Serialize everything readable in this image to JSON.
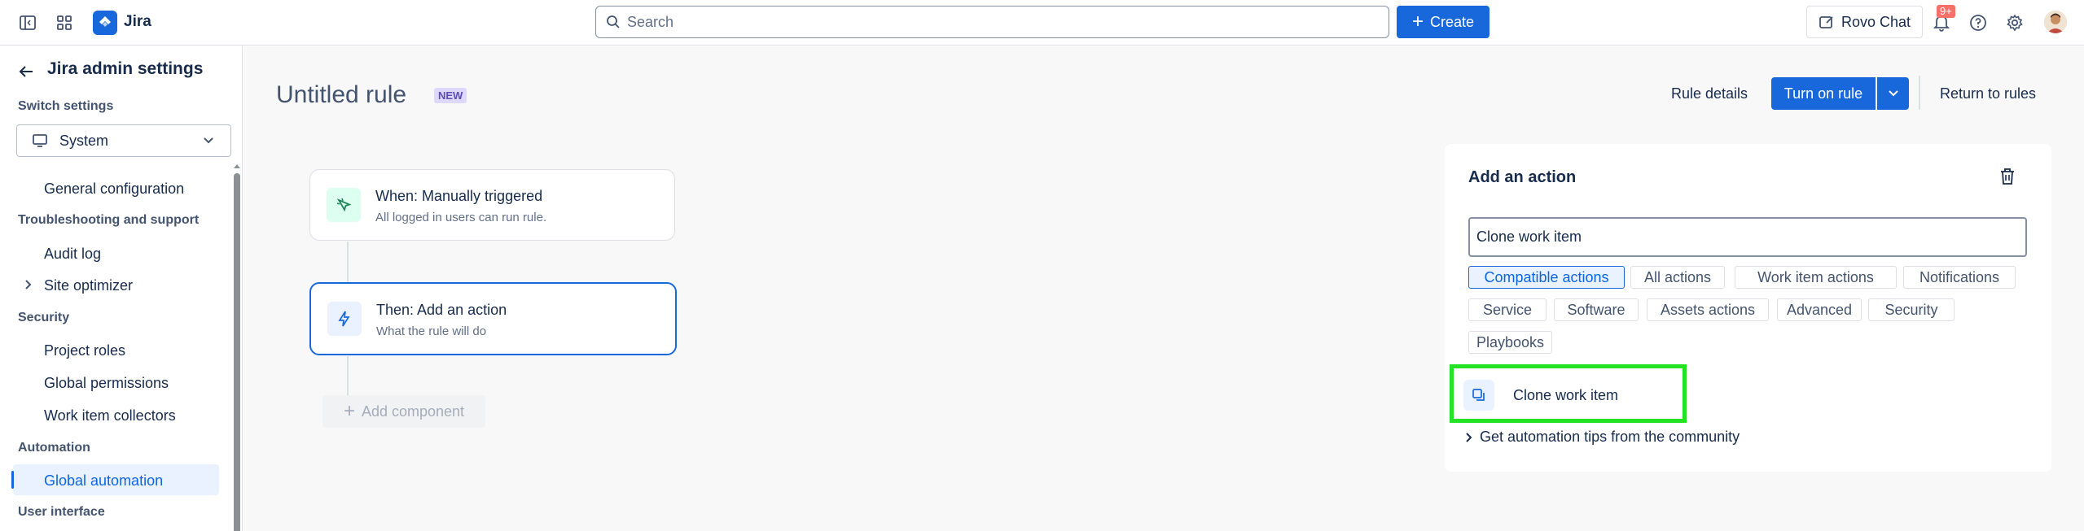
{
  "topbar": {
    "app_name": "Jira",
    "search_placeholder": "Search",
    "create_label": "Create",
    "rovo_label": "Rovo Chat",
    "notifications_badge": "9+"
  },
  "sidebar": {
    "title": "Jira admin settings",
    "switch_label": "Switch settings",
    "switch_value": "System",
    "items": [
      {
        "type": "item",
        "label": "General configuration"
      },
      {
        "type": "section",
        "label": "Troubleshooting and support"
      },
      {
        "type": "item",
        "label": "Audit log"
      },
      {
        "type": "item",
        "label": "Site optimizer"
      },
      {
        "type": "section",
        "label": "Security"
      },
      {
        "type": "item",
        "label": "Project roles"
      },
      {
        "type": "item",
        "label": "Global permissions"
      },
      {
        "type": "item",
        "label": "Work item collectors"
      },
      {
        "type": "section",
        "label": "Automation"
      },
      {
        "type": "item",
        "label": "Global automation",
        "active": true
      },
      {
        "type": "section",
        "label": "User interface"
      }
    ]
  },
  "header": {
    "rule_title": "Untitled rule",
    "new_badge": "NEW",
    "rule_details": "Rule details",
    "turn_on": "Turn on rule",
    "return": "Return to rules"
  },
  "flow": {
    "trigger": {
      "title": "When: Manually triggered",
      "subtitle": "All logged in users can run rule."
    },
    "action": {
      "title": "Then: Add an action",
      "subtitle": "What the rule will do"
    },
    "add_component": "Add component"
  },
  "panel": {
    "title": "Add an action",
    "search_value": "Clone work item",
    "chips": [
      "Compatible actions",
      "All actions",
      "Work item actions",
      "Notifications",
      "Service",
      "Software",
      "Assets actions",
      "Advanced",
      "Security",
      "Playbooks"
    ],
    "selected_chip": "Compatible actions",
    "result_label": "Clone work item",
    "tips": "Get automation tips from the community"
  },
  "colors": {
    "accent": "#1868db",
    "highlight": "#24e324"
  }
}
